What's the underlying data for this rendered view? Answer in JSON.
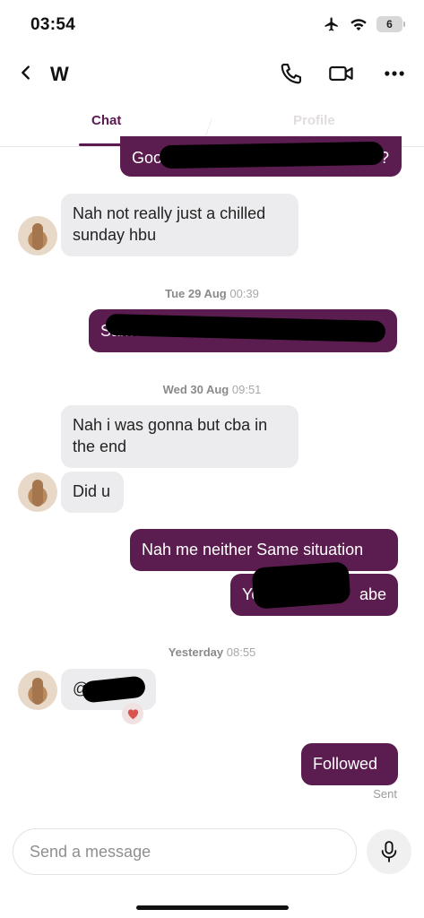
{
  "status_bar": {
    "time": "03:54",
    "battery": "6"
  },
  "header": {
    "contact_name": "W"
  },
  "tabs": {
    "chat": "Chat",
    "profile": "Profile"
  },
  "messages": {
    "m1_partial": "Goo",
    "m1_tail": "?",
    "m2_line1": "Nah not really just a chilled",
    "m2_line2": "sunday hbu",
    "ts1_day": "Tue 29 Aug",
    "ts1_time": "00:39",
    "m3_prefix": "Same",
    "m3_tail": "?",
    "ts2_day": "Wed 30 Aug",
    "ts2_time": "09:51",
    "m4_line1": "Nah i was gonna but cba in",
    "m4_line2": "the end",
    "m5": "Did u",
    "m6": "Nah me neither Same situation",
    "m7_prefix": "Yo",
    "m7_suffix": "abe",
    "ts3_day": "Yesterday",
    "ts3_time": "08:55",
    "m8_prefix": "@",
    "m9": "Followed",
    "sent_status": "Sent"
  },
  "composer": {
    "placeholder": "Send a message"
  },
  "icons": {
    "back": "chevron-left-icon",
    "call": "phone-icon",
    "video": "video-camera-icon",
    "more": "more-horizontal-icon",
    "reaction": "heart-icon",
    "mic": "microphone-icon"
  },
  "colors": {
    "accent": "#5b1d4f",
    "incoming_bubble": "#ececee",
    "heart": "#d9534f"
  }
}
